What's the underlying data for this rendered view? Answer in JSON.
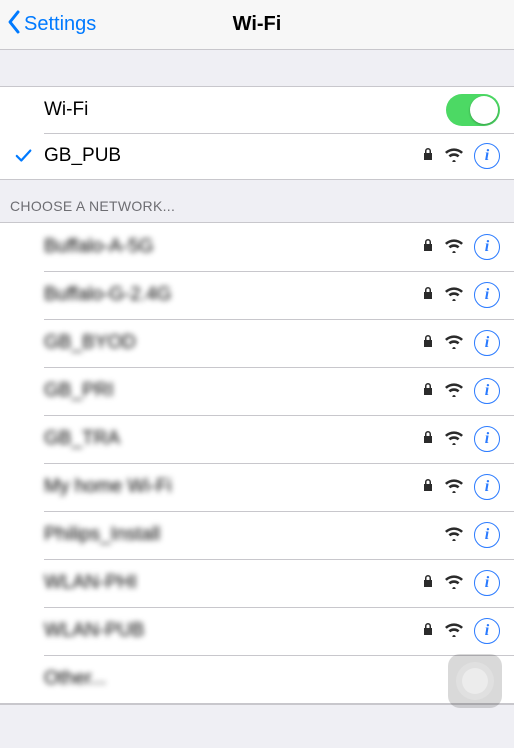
{
  "nav": {
    "back": "Settings",
    "title": "Wi-Fi"
  },
  "wifi_toggle": {
    "label": "Wi-Fi",
    "on": true
  },
  "connected": {
    "name": "GB_PUB",
    "secure": true
  },
  "choose_header": "Choose a Network...",
  "networks": [
    {
      "name": "Buffalo-A-5G",
      "secure": true,
      "blurred": true
    },
    {
      "name": "Buffalo-G-2.4G",
      "secure": true,
      "blurred": true
    },
    {
      "name": "GB_BYOD",
      "secure": true,
      "blurred": true
    },
    {
      "name": "GB_PRI",
      "secure": true,
      "blurred": true
    },
    {
      "name": "GB_TRA",
      "secure": true,
      "blurred": true
    },
    {
      "name": "My home Wi-Fi",
      "secure": true,
      "blurred": true
    },
    {
      "name": "Philips_Install",
      "secure": false,
      "blurred": true
    },
    {
      "name": "WLAN-PHI",
      "secure": true,
      "blurred": true
    },
    {
      "name": "WLAN-PUB",
      "secure": true,
      "blurred": true
    }
  ],
  "other_label": "Other...",
  "icons": {
    "info_glyph": "i"
  }
}
